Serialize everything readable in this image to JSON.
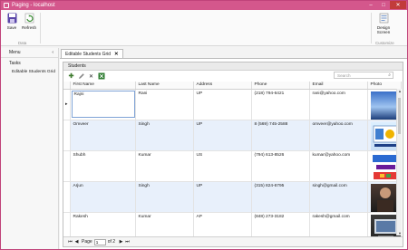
{
  "window": {
    "title": "Paging - localhost",
    "minimize": "–",
    "maximize": "□",
    "close": "✕"
  },
  "ribbon": {
    "save_label": "Save",
    "refresh_label": "Refresh",
    "data_group": "Data",
    "design_label": "Design Screen",
    "customize_group": "Customize"
  },
  "nav": {
    "menu_label": "Menu",
    "menu_chevron": "‹",
    "tasks_label": "Tasks",
    "items": [
      {
        "label": "Editable Students Grid"
      }
    ]
  },
  "tab": {
    "label": "Editable Students Grid",
    "close": "✕"
  },
  "grid": {
    "title": "Students",
    "search_placeholder": "Search",
    "columns": [
      "First Name",
      "Last Name",
      "Address",
      "Phone",
      "Email",
      "Photo"
    ],
    "selected_indicator": "▸",
    "rows": [
      {
        "first": "Rajni",
        "last": "Rani",
        "address": "UP",
        "phone": "(218) 794-6421",
        "email": "rani@yahoo.com"
      },
      {
        "first": "Omveer",
        "last": "Singh",
        "address": "UP",
        "phone": "8 (569) 745-2588",
        "email": "omveer@yahoo.com"
      },
      {
        "first": "Shubh",
        "last": "Kumar",
        "address": "US",
        "phone": "(794) 613-8526",
        "email": "kumar@yahoo.com"
      },
      {
        "first": "Arjun",
        "last": "Singh",
        "address": "UP",
        "phone": "(315) 824-6795",
        "email": "singh@gmail.com"
      },
      {
        "first": "Rakesh",
        "last": "Kumar",
        "address": "AP",
        "phone": "(848) 273-3182",
        "email": "rakesh@gmail.com"
      }
    ]
  },
  "pager": {
    "first": "⏮",
    "prev": "◀",
    "page_label": "Page",
    "page_value": "1",
    "of_label": "of 2",
    "next": "▶",
    "last": "⏭"
  },
  "colors": {
    "title_bar": "#d4578c",
    "alt_row": "#e8f0fb",
    "accent": "#3d7a2e"
  }
}
